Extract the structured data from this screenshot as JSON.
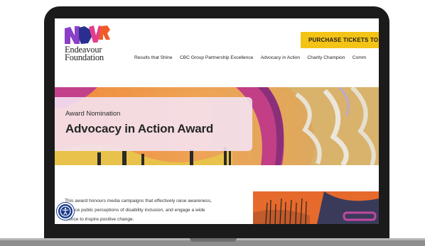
{
  "header": {
    "logo_line1": "Endeavour",
    "logo_line2": "Foundation",
    "cta_label": "PURCHASE TICKETS TO",
    "nav": [
      "Results that Shine",
      "CBC Group Partnership Excellence",
      "Advocacy in Action",
      "Charity Champion",
      "Comm"
    ]
  },
  "hero": {
    "eyebrow": "Award Nomination",
    "title": "Advocacy in Action Award"
  },
  "body": {
    "intro_lines": [
      "This award honours media campaigns that effectively raise awareness,",
      "fluence public perceptions of disability inclusion, and engage a wide",
      "dience to inspire positive change."
    ]
  },
  "icons": {
    "accessibility": "accessibility-icon",
    "logo": "ndvr-logo-icon"
  },
  "colors": {
    "cta": "#f3c316",
    "hero_card": "#f4e2f1",
    "a11y": "#1b3a8c"
  }
}
